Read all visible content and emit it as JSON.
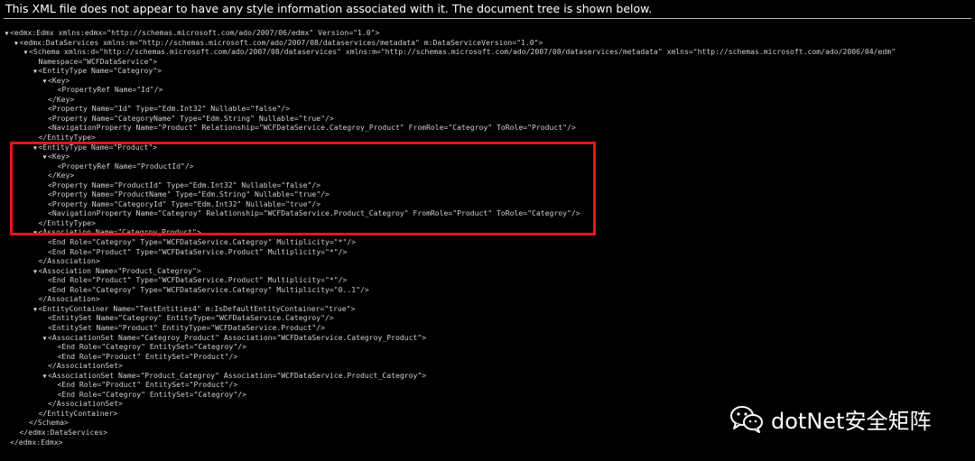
{
  "banner": {
    "text": "This XML file does not appear to have any style information associated with it. The document tree is shown below."
  },
  "tree": {
    "toggle_glyph": "▼",
    "lines": [
      {
        "indent": 0,
        "toggle": true,
        "text": "<edmx:Edmx xmlns:edmx=\"http://schemas.microsoft.com/ado/2007/06/edmx\" Version=\"1.0\">"
      },
      {
        "indent": 1,
        "toggle": true,
        "text": "<edmx:DataServices xmlns:m=\"http://schemas.microsoft.com/ado/2007/08/dataservices/metadata\" m:DataServiceVersion=\"1.0\">"
      },
      {
        "indent": 2,
        "toggle": true,
        "text": "<Schema xmlns:d=\"http://schemas.microsoft.com/ado/2007/08/dataservices\" xmlns:m=\"http://schemas.microsoft.com/ado/2007/08/dataservices/metadata\" xmlns=\"http://schemas.microsoft.com/ado/2006/04/edm\""
      },
      {
        "indent": 3,
        "toggle": false,
        "text": "Namespace=\"WCFDataService\">"
      },
      {
        "indent": 3,
        "toggle": true,
        "text": "<EntityType Name=\"Categroy\">"
      },
      {
        "indent": 4,
        "toggle": true,
        "text": "<Key>"
      },
      {
        "indent": 5,
        "toggle": false,
        "text": "<PropertyRef Name=\"Id\"/>"
      },
      {
        "indent": 4,
        "toggle": false,
        "text": "</Key>"
      },
      {
        "indent": 4,
        "toggle": false,
        "text": "<Property Name=\"Id\" Type=\"Edm.Int32\" Nullable=\"false\"/>"
      },
      {
        "indent": 4,
        "toggle": false,
        "text": "<Property Name=\"CategoryName\" Type=\"Edm.String\" Nullable=\"true\"/>"
      },
      {
        "indent": 4,
        "toggle": false,
        "text": "<NavigationProperty Name=\"Product\" Relationship=\"WCFDataService.Categroy_Product\" FromRole=\"Categroy\" ToRole=\"Product\"/>"
      },
      {
        "indent": 3,
        "toggle": false,
        "text": "</EntityType>"
      },
      {
        "indent": 3,
        "toggle": true,
        "text": "<EntityType Name=\"Product\">"
      },
      {
        "indent": 4,
        "toggle": true,
        "text": "<Key>"
      },
      {
        "indent": 5,
        "toggle": false,
        "text": "<PropertyRef Name=\"ProductId\"/>"
      },
      {
        "indent": 4,
        "toggle": false,
        "text": "</Key>"
      },
      {
        "indent": 4,
        "toggle": false,
        "text": "<Property Name=\"ProductId\" Type=\"Edm.Int32\" Nullable=\"false\"/>"
      },
      {
        "indent": 4,
        "toggle": false,
        "text": "<Property Name=\"ProductName\" Type=\"Edm.String\" Nullable=\"true\"/>"
      },
      {
        "indent": 4,
        "toggle": false,
        "text": "<Property Name=\"CategoryId\" Type=\"Edm.Int32\" Nullable=\"true\"/>"
      },
      {
        "indent": 4,
        "toggle": false,
        "text": "<NavigationProperty Name=\"Categroy\" Relationship=\"WCFDataService.Product_Categroy\" FromRole=\"Product\" ToRole=\"Categroy\"/>"
      },
      {
        "indent": 3,
        "toggle": false,
        "text": "</EntityType>"
      },
      {
        "indent": 3,
        "toggle": true,
        "text": "<Association Name=\"Categroy_Product\">"
      },
      {
        "indent": 4,
        "toggle": false,
        "text": "<End Role=\"Categroy\" Type=\"WCFDataService.Categroy\" Multiplicity=\"*\"/>"
      },
      {
        "indent": 4,
        "toggle": false,
        "text": "<End Role=\"Product\" Type=\"WCFDataService.Product\" Multiplicity=\"*\"/>"
      },
      {
        "indent": 3,
        "toggle": false,
        "text": "</Association>"
      },
      {
        "indent": 3,
        "toggle": true,
        "text": "<Association Name=\"Product_Categroy\">"
      },
      {
        "indent": 4,
        "toggle": false,
        "text": "<End Role=\"Product\" Type=\"WCFDataService.Product\" Multiplicity=\"*\"/>"
      },
      {
        "indent": 4,
        "toggle": false,
        "text": "<End Role=\"Categroy\" Type=\"WCFDataService.Categroy\" Multiplicity=\"0..1\"/>"
      },
      {
        "indent": 3,
        "toggle": false,
        "text": "</Association>"
      },
      {
        "indent": 3,
        "toggle": true,
        "text": "<EntityContainer Name=\"TestEntities4\" m:IsDefaultEntityContainer=\"true\">"
      },
      {
        "indent": 4,
        "toggle": false,
        "text": "<EntitySet Name=\"Categroy\" EntityType=\"WCFDataService.Categroy\"/>"
      },
      {
        "indent": 4,
        "toggle": false,
        "text": "<EntitySet Name=\"Product\" EntityType=\"WCFDataService.Product\"/>"
      },
      {
        "indent": 4,
        "toggle": true,
        "text": "<AssociationSet Name=\"Categroy_Product\" Association=\"WCFDataService.Categroy_Product\">"
      },
      {
        "indent": 5,
        "toggle": false,
        "text": "<End Role=\"Categroy\" EntitySet=\"Categroy\"/>"
      },
      {
        "indent": 5,
        "toggle": false,
        "text": "<End Role=\"Product\" EntitySet=\"Product\"/>"
      },
      {
        "indent": 4,
        "toggle": false,
        "text": "</AssociationSet>"
      },
      {
        "indent": 4,
        "toggle": true,
        "text": "<AssociationSet Name=\"Product_Categroy\" Association=\"WCFDataService.Product_Categroy\">"
      },
      {
        "indent": 5,
        "toggle": false,
        "text": "<End Role=\"Product\" EntitySet=\"Product\"/>"
      },
      {
        "indent": 5,
        "toggle": false,
        "text": "<End Role=\"Categroy\" EntitySet=\"Categroy\"/>"
      },
      {
        "indent": 4,
        "toggle": false,
        "text": "</AssociationSet>"
      },
      {
        "indent": 3,
        "toggle": false,
        "text": "</EntityContainer>"
      },
      {
        "indent": 2,
        "toggle": false,
        "text": "</Schema>"
      },
      {
        "indent": 1,
        "toggle": false,
        "text": "</edmx:DataServices>"
      },
      {
        "indent": 0,
        "toggle": false,
        "text": "</edmx:Edmx>"
      }
    ]
  },
  "highlight": {
    "color": "#e8151b"
  },
  "watermark": {
    "icon": "wechat-icon",
    "text": "dotNet安全矩阵"
  },
  "colors": {
    "background": "#000000",
    "text": "#cfcfcf",
    "banner_text": "#ffffff"
  }
}
